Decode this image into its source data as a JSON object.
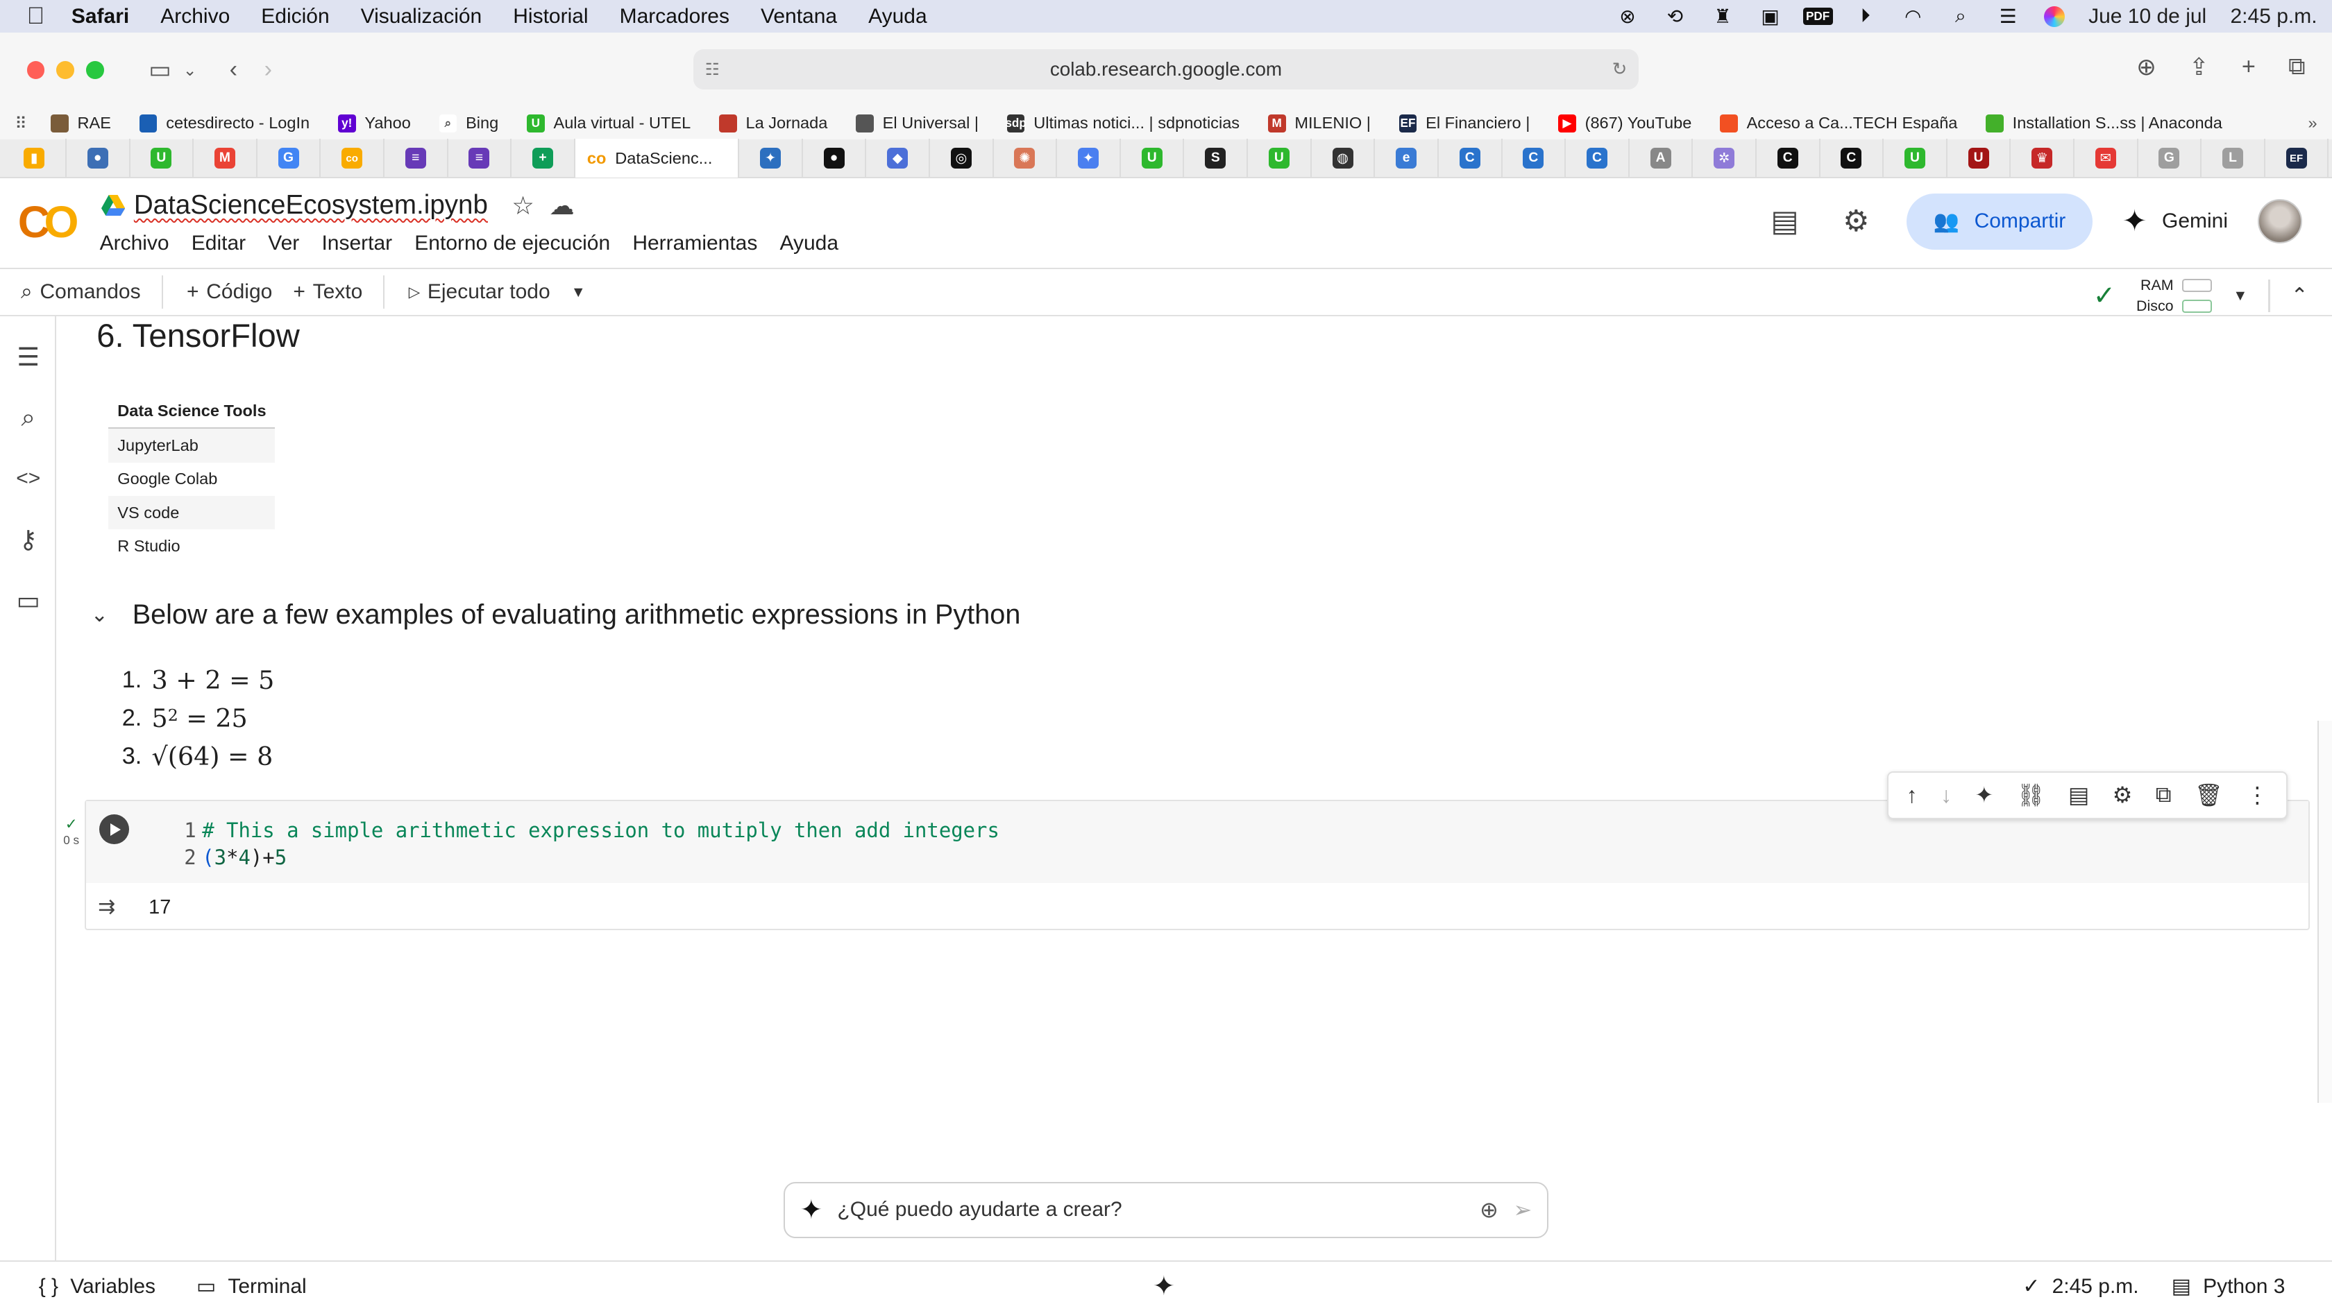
{
  "menubar": {
    "apple": "",
    "items": [
      "Safari",
      "Archivo",
      "Edición",
      "Visualización",
      "Historial",
      "Marcadores",
      "Ventana",
      "Ayuda"
    ],
    "date": "Jue 10 de jul",
    "time": "2:45 p.m.",
    "pdf_label": "PDF"
  },
  "safari": {
    "url": "colab.research.google.com"
  },
  "bookmarks": [
    {
      "label": "RAE",
      "icon": "rae-icon",
      "color": "#7a5c3a"
    },
    {
      "label": "cetesdirecto - LogIn",
      "icon": "cetes-icon",
      "color": "#1a5fb4"
    },
    {
      "label": "Yahoo",
      "icon": "yahoo-icon",
      "color": "#6001d2",
      "glyph": "y!"
    },
    {
      "label": "Bing",
      "icon": "search-icon",
      "color": "#ffffff"
    },
    {
      "label": "Aula virtual - UTEL",
      "icon": "utel-icon",
      "color": "#2eb82e",
      "glyph": "U"
    },
    {
      "label": "La Jornada",
      "icon": "jornada-icon",
      "color": "#c0392b"
    },
    {
      "label": "El Universal |",
      "icon": "universal-icon",
      "color": "#555"
    },
    {
      "label": "Ultimas notici... | sdpnoticias",
      "icon": "sdp-icon",
      "color": "#333",
      "glyph": "sdp"
    },
    {
      "label": "MILENIO |",
      "icon": "milenio-icon",
      "color": "#c0392b",
      "glyph": "M"
    },
    {
      "label": "El Financiero |",
      "icon": "financiero-icon",
      "color": "#1b2a4a",
      "glyph": "EF"
    },
    {
      "label": "(867) YouTube",
      "icon": "youtube-icon",
      "color": "#ff0000",
      "glyph": "▶"
    },
    {
      "label": "Acceso a Ca...TECH España",
      "icon": "microsoft-icon",
      "color": "#f25022"
    },
    {
      "label": "Installation S...ss | Anaconda",
      "icon": "anaconda-icon",
      "color": "#43b02a"
    }
  ],
  "tabs": {
    "active_label": "DataScienc...",
    "icons": [
      {
        "name": "sheets-yellow-icon",
        "color": "#f9ab00",
        "glyph": "▮"
      },
      {
        "name": "globe-icon",
        "color": "#3d6fb5",
        "glyph": "●"
      },
      {
        "name": "utel-icon",
        "color": "#2eb82e",
        "glyph": "U"
      },
      {
        "name": "gmail-icon",
        "color": "#ea4335",
        "glyph": "M"
      },
      {
        "name": "google-icon",
        "color": "#4285f4",
        "glyph": "G"
      },
      {
        "name": "colab-icon",
        "color": "#f9ab00",
        "glyph": "co"
      },
      {
        "name": "forms-icon",
        "color": "#673ab7",
        "glyph": "≡"
      },
      {
        "name": "forms-icon-2",
        "color": "#673ab7",
        "glyph": "≡"
      },
      {
        "name": "sheets-icon",
        "color": "#0f9d58",
        "glyph": "+"
      }
    ],
    "icons_after": [
      {
        "name": "jupyter-icon",
        "color": "#2c6fbf",
        "glyph": "✦"
      },
      {
        "name": "github-icon",
        "color": "#111111",
        "glyph": "●"
      },
      {
        "name": "copilot-icon",
        "color": "#4c6fd8",
        "glyph": "◆"
      },
      {
        "name": "chatgpt-icon",
        "color": "#111111",
        "glyph": "◎"
      },
      {
        "name": "claude-icon",
        "color": "#d97757",
        "glyph": "✺"
      },
      {
        "name": "gemini-icon",
        "color": "#4a7ff0",
        "glyph": "✦"
      },
      {
        "name": "utel-icon-2",
        "color": "#2eb82e",
        "glyph": "U"
      },
      {
        "name": "scribd-icon",
        "color": "#222222",
        "glyph": "S"
      },
      {
        "name": "utel-icon-3",
        "color": "#2eb82e",
        "glyph": "U"
      },
      {
        "name": "perplexity-icon",
        "color": "#333333",
        "glyph": "◍"
      },
      {
        "name": "edge-icon",
        "color": "#3a7bd5",
        "glyph": "e"
      },
      {
        "name": "coursera-icon",
        "color": "#2a73cc",
        "glyph": "C"
      },
      {
        "name": "coursera-icon-2",
        "color": "#2a73cc",
        "glyph": "C"
      },
      {
        "name": "coursera-icon-3",
        "color": "#2a73cc",
        "glyph": "C"
      },
      {
        "name": "a-icon",
        "color": "#888888",
        "glyph": "A"
      },
      {
        "name": "gear-tab-icon",
        "color": "#8f7bd8",
        "glyph": "✲"
      },
      {
        "name": "chrome-dark-icon",
        "color": "#111111",
        "glyph": "C"
      },
      {
        "name": "chrome-dark-icon-2",
        "color": "#111111",
        "glyph": "C"
      },
      {
        "name": "utel-icon-4",
        "color": "#2eb82e",
        "glyph": "U"
      },
      {
        "name": "u-red-icon",
        "color": "#a31515",
        "glyph": "U"
      },
      {
        "name": "crown-icon",
        "color": "#c62828",
        "glyph": "♛"
      },
      {
        "name": "mail-red-icon",
        "color": "#e53935",
        "glyph": "✉"
      },
      {
        "name": "g-gray-icon",
        "color": "#9e9e9e",
        "glyph": "G"
      },
      {
        "name": "l-gray-icon",
        "color": "#9e9e9e",
        "glyph": "L"
      },
      {
        "name": "ef-icon",
        "color": "#1b2a4a",
        "glyph": "EF"
      }
    ]
  },
  "colab": {
    "logo": "CO",
    "notebook_title": "DataScienceEcosystem.ipynb",
    "menu": [
      "Archivo",
      "Editar",
      "Ver",
      "Insertar",
      "Entorno de ejecución",
      "Herramientas",
      "Ayuda"
    ],
    "share_label": "Compartir",
    "gemini_label": "Gemini",
    "toolbar": {
      "commands": "Comandos",
      "code": "Código",
      "text": "Texto",
      "run_all": "Ejecutar todo",
      "ram": "RAM",
      "disk": "Disco"
    },
    "statusbar": {
      "variables": "Variables",
      "terminal": "Terminal",
      "time": "2:45 p.m.",
      "runtime": "Python 3"
    }
  },
  "notebook": {
    "heading_tensorflow": "6. TensorFlow",
    "table": {
      "header": "Data Science Tools",
      "rows": [
        "JupyterLab",
        "Google Colab",
        "VS code",
        "R Studio"
      ]
    },
    "section_title": "Below are a few examples of evaluating arithmetic expressions in Python",
    "math": [
      {
        "n": "1.",
        "expr": "3 + 2 = 5"
      },
      {
        "n": "2.",
        "base": "5",
        "exp": "2",
        "rest": " = 25"
      },
      {
        "n": "3.",
        "expr": "√(64) = 8"
      }
    ],
    "cell": {
      "exec_time": "0 s",
      "line1_no": "1",
      "line1": "# This a simple arithmetic expression to mutiply then add integers",
      "line2_no": "2",
      "line2_a": "(",
      "line2_b": "3",
      "line2_c": "*",
      "line2_d": "4",
      "line2_e": ")+",
      "line2_f": "5",
      "output": "17"
    },
    "prompt_placeholder": "¿Qué puedo ayudarte a crear?"
  }
}
